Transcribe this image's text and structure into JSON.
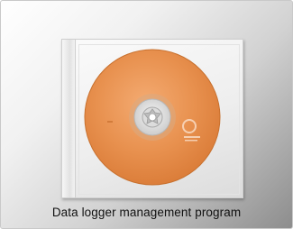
{
  "caption": "Data logger management program",
  "image": {
    "subject": "cd-case-icon",
    "disc_color": "#e8914f",
    "background_light": "#ffffff",
    "background_dark": "#8d8d8d"
  }
}
